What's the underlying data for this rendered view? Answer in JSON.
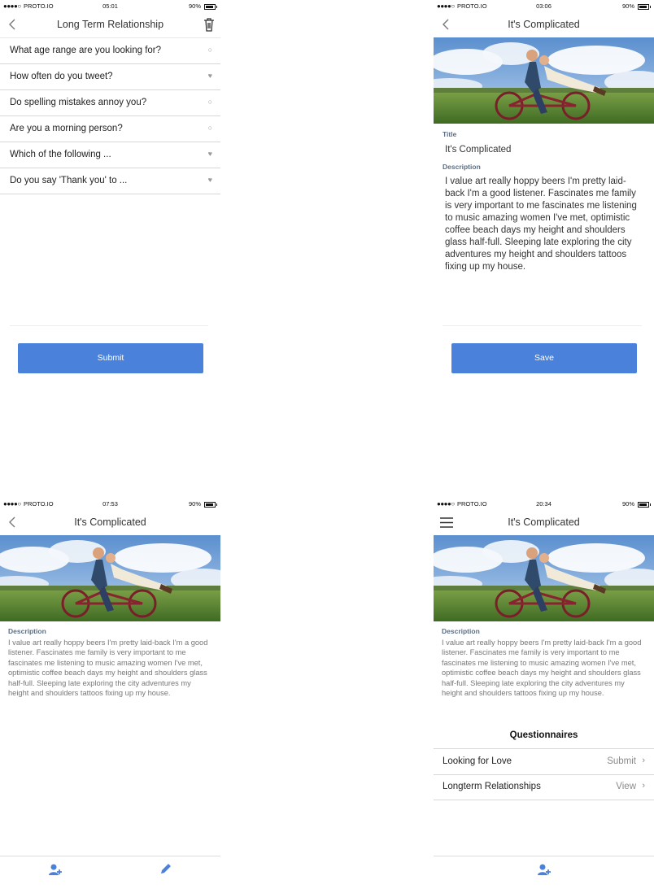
{
  "screens": {
    "questions": {
      "status": {
        "dots": "●●●●○",
        "carrier": "PROTO.IO",
        "time": "05:01",
        "battery": "90%"
      },
      "title": "Long Term Relationship",
      "items": [
        {
          "label": "What age range are you looking for?",
          "mark": "○"
        },
        {
          "label": "How often do you tweet?",
          "mark": "♥"
        },
        {
          "label": "Do spelling mistakes annoy you?",
          "mark": "○"
        },
        {
          "label": "Are you a morning person?",
          "mark": "○"
        },
        {
          "label": "Which of the following ...",
          "mark": "♥"
        },
        {
          "label": "Do you say 'Thank you' to ...",
          "mark": "♥"
        }
      ],
      "submit_label": "Submit"
    },
    "edit": {
      "status": {
        "dots": "●●●●○",
        "carrier": "PROTO.IO",
        "time": "03:06",
        "battery": "90%"
      },
      "title": "It's Complicated",
      "title_label": "Title",
      "title_value": "It's Complicated",
      "description_label": "Description",
      "description_value": "I value art really hoppy beers I'm pretty laid-back I'm a good listener. Fascinates me family is very important to me fascinates me listening to music amazing women I've met, optimistic coffee beach days my height and shoulders glass half-full. Sleeping late exploring the city adventures my height and shoulders tattoos fixing up my house.",
      "save_label": "Save"
    },
    "view": {
      "status": {
        "dots": "●●●●○",
        "carrier": "PROTO.IO",
        "time": "07:53",
        "battery": "90%"
      },
      "title": "It's Complicated",
      "description_label": "Description",
      "description_value": "I value art really hoppy beers I'm pretty laid-back I'm a good listener. Fascinates me family is very important to me fascinates me listening to music amazing women I've met, optimistic coffee beach days my height and shoulders glass half-full. Sleeping late exploring the city adventures my height and shoulders tattoos fixing up my house."
    },
    "menu": {
      "status": {
        "dots": "●●●●○",
        "carrier": "PROTO.IO",
        "time": "20:34",
        "battery": "90%"
      },
      "title": "It's Complicated",
      "description_label": "Description",
      "description_value": "I value art really hoppy beers I'm pretty laid-back I'm a good listener. Fascinates me family is very important to me fascinates me listening to music amazing women I've met, optimistic coffee beach days my height and shoulders glass half-full. Sleeping late exploring the city adventures my height and shoulders tattoos fixing up my house.",
      "questionnaires_heading": "Questionnaires",
      "questionnaires": [
        {
          "label": "Looking for Love",
          "action": "Submit"
        },
        {
          "label": "Longterm Relationships",
          "action": "View"
        }
      ]
    }
  },
  "colors": {
    "accent": "#4a81da",
    "label": "#5a6f86"
  },
  "icons": {
    "back": "chevron-left-icon",
    "trash": "trash-icon",
    "menu": "hamburger-icon",
    "add_user": "add-user-icon",
    "edit": "pencil-icon"
  }
}
